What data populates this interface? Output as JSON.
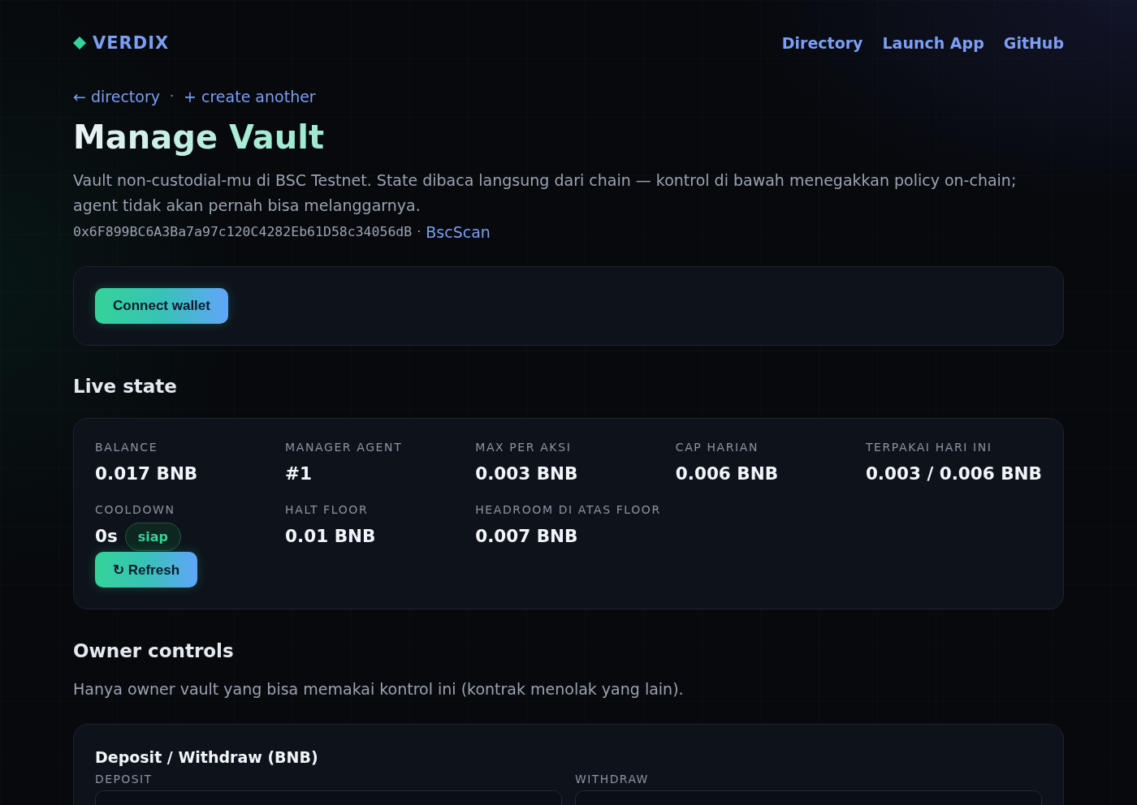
{
  "header": {
    "brand": "VERDIX",
    "nav": [
      {
        "label": "Directory"
      },
      {
        "label": "Launch App"
      },
      {
        "label": "GitHub"
      }
    ]
  },
  "breadcrumbs": {
    "links": [
      "← directory",
      "+ create another"
    ],
    "separator": "·"
  },
  "title": "Manage Vault",
  "description": "Vault non-custodial-mu di BSC Testnet. State dibaca langsung dari chain — kontrol di bawah menegakkan policy on-chain; agent tidak akan pernah bisa melanggarnya.",
  "address": {
    "value": "0x6F899BC6A3Ba7a97c120C4282Eb61D58c34056dB",
    "separator": "·",
    "link": "BscScan"
  },
  "wallet_panel": {
    "button": "Connect wallet"
  },
  "live_state": {
    "heading": "Live state",
    "stats": [
      {
        "kind": "value",
        "label": "BALANCE",
        "value": "0.017 BNB"
      },
      {
        "kind": "value",
        "label": "MANAGER AGENT",
        "value": "#1"
      },
      {
        "kind": "value",
        "label": "MAX PER AKSI",
        "value": "0.003 BNB"
      },
      {
        "kind": "value",
        "label": "CAP HARIAN",
        "value": "0.006 BNB"
      },
      {
        "kind": "value",
        "label": "TERPAKAI HARI INI",
        "value": "0.003 / 0.006 BNB"
      },
      {
        "kind": "cooldown",
        "label": "COOLDOWN",
        "value": "0s",
        "badge": "siap",
        "button": "↻ Refresh"
      },
      {
        "kind": "value",
        "label": "HALT FLOOR",
        "value": "0.01 BNB"
      },
      {
        "kind": "value",
        "label": "HEADROOM DI ATAS FLOOR",
        "value": "0.007 BNB"
      }
    ]
  },
  "owner_controls": {
    "heading": "Owner controls",
    "note": "Hanya owner vault yang bisa memakai kontrol ini (kontrak menolak yang lain).",
    "deposit_withdraw": {
      "title": "Deposit / Withdraw (BNB)",
      "fields": [
        {
          "label": "DEPOSIT"
        },
        {
          "label": "WITHDRAW"
        }
      ]
    }
  }
}
